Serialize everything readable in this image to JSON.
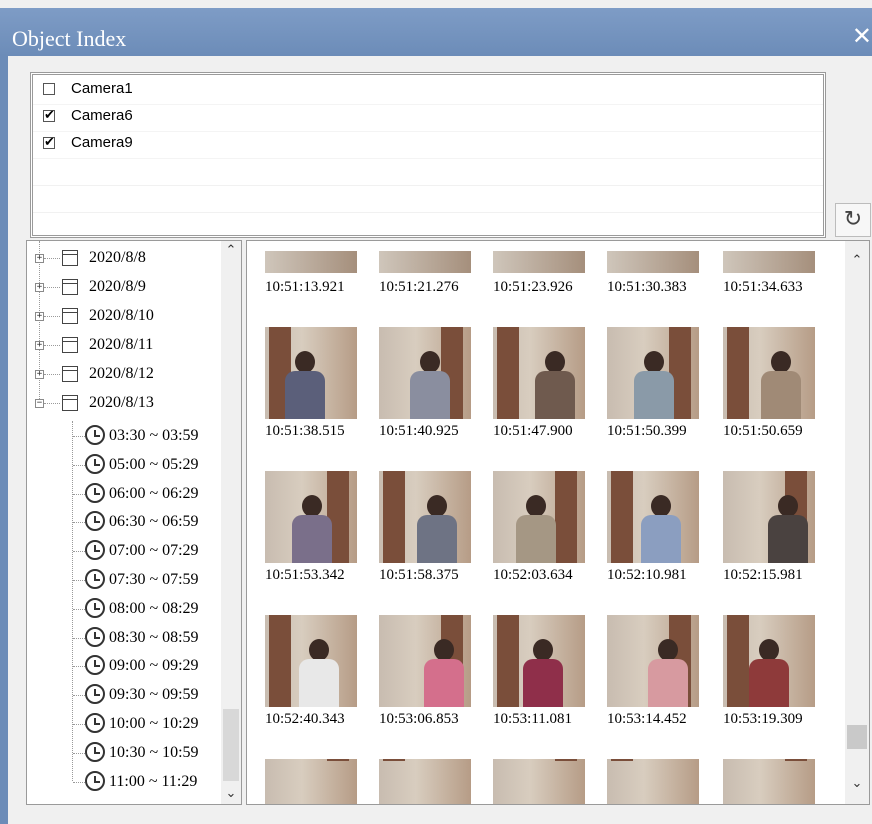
{
  "window": {
    "title": "Object Index",
    "close_glyph": "✕"
  },
  "cameras": [
    {
      "label": "Camera1",
      "checked": false
    },
    {
      "label": "Camera6",
      "checked": true
    },
    {
      "label": "Camera9",
      "checked": true
    }
  ],
  "refresh_icon": "refresh-icon",
  "tree": {
    "dates": [
      {
        "label": "2020/8/8",
        "expanded": false
      },
      {
        "label": "2020/8/9",
        "expanded": false
      },
      {
        "label": "2020/8/10",
        "expanded": false
      },
      {
        "label": "2020/8/11",
        "expanded": false
      },
      {
        "label": "2020/8/12",
        "expanded": false
      },
      {
        "label": "2020/8/13",
        "expanded": true
      }
    ],
    "times": [
      "03:30 ~ 03:59",
      "05:00 ~ 05:29",
      "06:00 ~ 06:29",
      "06:30 ~ 06:59",
      "07:00 ~ 07:29",
      "07:30 ~ 07:59",
      "08:00 ~ 08:29",
      "08:30 ~ 08:59",
      "09:00 ~ 09:29",
      "09:30 ~ 09:59",
      "10:00 ~ 10:29",
      "10:30 ~ 10:59",
      "11:00 ~ 11:29"
    ]
  },
  "grid": {
    "rows": [
      [
        "10:51:13.921",
        "10:51:21.276",
        "10:51:23.926",
        "10:51:30.383",
        "10:51:34.633"
      ],
      [
        "10:51:38.515",
        "10:51:40.925",
        "10:51:47.900",
        "10:51:50.399",
        "10:51:50.659"
      ],
      [
        "10:51:53.342",
        "10:51:58.375",
        "10:52:03.634",
        "10:52:10.981",
        "10:52:15.981"
      ],
      [
        "10:52:40.343",
        "10:53:06.853",
        "10:53:11.081",
        "10:53:14.452",
        "10:53:19.309"
      ]
    ],
    "shirt_colors": [
      [
        "#5b5f7a",
        "#8a8e9f",
        "#6f5a4e",
        "#8a9aa8",
        "#a08a76"
      ],
      [
        "#7a6f8a",
        "#6e7384",
        "#a59784",
        "#8b9ec0",
        "#4a4240"
      ],
      [
        "#e8e8e8",
        "#d46f8c",
        "#8f2f4a",
        "#d79aa0",
        "#8e3a3a"
      ],
      [
        "#2f2a2a",
        "#4d4553",
        "#c9b8ad",
        "#e6e6e6",
        "#3f5f8e"
      ]
    ]
  }
}
